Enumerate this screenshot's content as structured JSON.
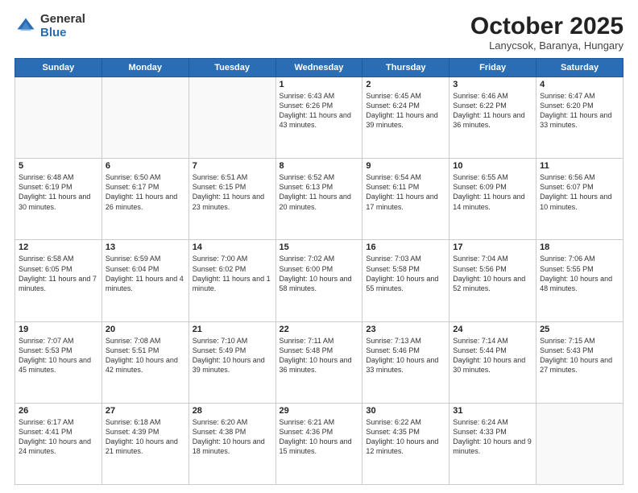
{
  "header": {
    "logo_general": "General",
    "logo_blue": "Blue",
    "month_title": "October 2025",
    "location": "Lanycsok, Baranya, Hungary"
  },
  "weekdays": [
    "Sunday",
    "Monday",
    "Tuesday",
    "Wednesday",
    "Thursday",
    "Friday",
    "Saturday"
  ],
  "weeks": [
    [
      {
        "day": "",
        "info": ""
      },
      {
        "day": "",
        "info": ""
      },
      {
        "day": "",
        "info": ""
      },
      {
        "day": "1",
        "info": "Sunrise: 6:43 AM\nSunset: 6:26 PM\nDaylight: 11 hours\nand 43 minutes."
      },
      {
        "day": "2",
        "info": "Sunrise: 6:45 AM\nSunset: 6:24 PM\nDaylight: 11 hours\nand 39 minutes."
      },
      {
        "day": "3",
        "info": "Sunrise: 6:46 AM\nSunset: 6:22 PM\nDaylight: 11 hours\nand 36 minutes."
      },
      {
        "day": "4",
        "info": "Sunrise: 6:47 AM\nSunset: 6:20 PM\nDaylight: 11 hours\nand 33 minutes."
      }
    ],
    [
      {
        "day": "5",
        "info": "Sunrise: 6:48 AM\nSunset: 6:19 PM\nDaylight: 11 hours\nand 30 minutes."
      },
      {
        "day": "6",
        "info": "Sunrise: 6:50 AM\nSunset: 6:17 PM\nDaylight: 11 hours\nand 26 minutes."
      },
      {
        "day": "7",
        "info": "Sunrise: 6:51 AM\nSunset: 6:15 PM\nDaylight: 11 hours\nand 23 minutes."
      },
      {
        "day": "8",
        "info": "Sunrise: 6:52 AM\nSunset: 6:13 PM\nDaylight: 11 hours\nand 20 minutes."
      },
      {
        "day": "9",
        "info": "Sunrise: 6:54 AM\nSunset: 6:11 PM\nDaylight: 11 hours\nand 17 minutes."
      },
      {
        "day": "10",
        "info": "Sunrise: 6:55 AM\nSunset: 6:09 PM\nDaylight: 11 hours\nand 14 minutes."
      },
      {
        "day": "11",
        "info": "Sunrise: 6:56 AM\nSunset: 6:07 PM\nDaylight: 11 hours\nand 10 minutes."
      }
    ],
    [
      {
        "day": "12",
        "info": "Sunrise: 6:58 AM\nSunset: 6:05 PM\nDaylight: 11 hours\nand 7 minutes."
      },
      {
        "day": "13",
        "info": "Sunrise: 6:59 AM\nSunset: 6:04 PM\nDaylight: 11 hours\nand 4 minutes."
      },
      {
        "day": "14",
        "info": "Sunrise: 7:00 AM\nSunset: 6:02 PM\nDaylight: 11 hours\nand 1 minute."
      },
      {
        "day": "15",
        "info": "Sunrise: 7:02 AM\nSunset: 6:00 PM\nDaylight: 10 hours\nand 58 minutes."
      },
      {
        "day": "16",
        "info": "Sunrise: 7:03 AM\nSunset: 5:58 PM\nDaylight: 10 hours\nand 55 minutes."
      },
      {
        "day": "17",
        "info": "Sunrise: 7:04 AM\nSunset: 5:56 PM\nDaylight: 10 hours\nand 52 minutes."
      },
      {
        "day": "18",
        "info": "Sunrise: 7:06 AM\nSunset: 5:55 PM\nDaylight: 10 hours\nand 48 minutes."
      }
    ],
    [
      {
        "day": "19",
        "info": "Sunrise: 7:07 AM\nSunset: 5:53 PM\nDaylight: 10 hours\nand 45 minutes."
      },
      {
        "day": "20",
        "info": "Sunrise: 7:08 AM\nSunset: 5:51 PM\nDaylight: 10 hours\nand 42 minutes."
      },
      {
        "day": "21",
        "info": "Sunrise: 7:10 AM\nSunset: 5:49 PM\nDaylight: 10 hours\nand 39 minutes."
      },
      {
        "day": "22",
        "info": "Sunrise: 7:11 AM\nSunset: 5:48 PM\nDaylight: 10 hours\nand 36 minutes."
      },
      {
        "day": "23",
        "info": "Sunrise: 7:13 AM\nSunset: 5:46 PM\nDaylight: 10 hours\nand 33 minutes."
      },
      {
        "day": "24",
        "info": "Sunrise: 7:14 AM\nSunset: 5:44 PM\nDaylight: 10 hours\nand 30 minutes."
      },
      {
        "day": "25",
        "info": "Sunrise: 7:15 AM\nSunset: 5:43 PM\nDaylight: 10 hours\nand 27 minutes."
      }
    ],
    [
      {
        "day": "26",
        "info": "Sunrise: 6:17 AM\nSunset: 4:41 PM\nDaylight: 10 hours\nand 24 minutes."
      },
      {
        "day": "27",
        "info": "Sunrise: 6:18 AM\nSunset: 4:39 PM\nDaylight: 10 hours\nand 21 minutes."
      },
      {
        "day": "28",
        "info": "Sunrise: 6:20 AM\nSunset: 4:38 PM\nDaylight: 10 hours\nand 18 minutes."
      },
      {
        "day": "29",
        "info": "Sunrise: 6:21 AM\nSunset: 4:36 PM\nDaylight: 10 hours\nand 15 minutes."
      },
      {
        "day": "30",
        "info": "Sunrise: 6:22 AM\nSunset: 4:35 PM\nDaylight: 10 hours\nand 12 minutes."
      },
      {
        "day": "31",
        "info": "Sunrise: 6:24 AM\nSunset: 4:33 PM\nDaylight: 10 hours\nand 9 minutes."
      },
      {
        "day": "",
        "info": ""
      }
    ]
  ]
}
